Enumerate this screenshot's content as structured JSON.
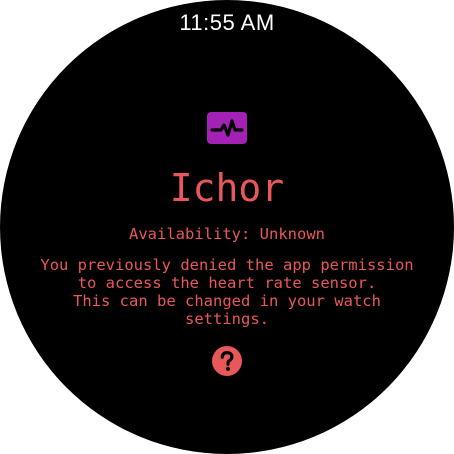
{
  "status_bar": {
    "time": "11:55 AM"
  },
  "app": {
    "icon": "heart-rate-icon",
    "title": "Ichor",
    "availability": "Availability: Unknown",
    "message_lines": [
      "You previously denied the app permission",
      "to access the heart rate sensor.",
      "This can be changed in your watch",
      "settings."
    ],
    "help_icon": "question-mark-icon"
  },
  "colors": {
    "accent_text": "#e8585a",
    "icon_purple": "#a322b5",
    "background": "#000000",
    "time_text": "#ffffff"
  }
}
